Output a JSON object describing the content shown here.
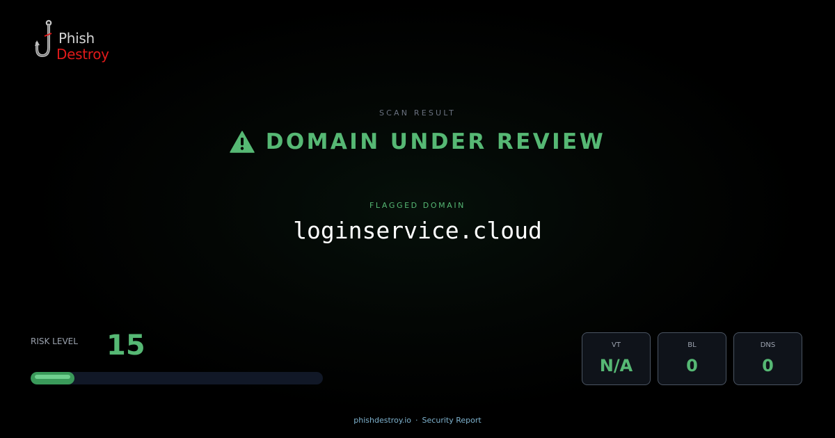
{
  "brand": {
    "line1": "Phish",
    "line2": "Destroy",
    "icon": "fishhook-icon",
    "colors": {
      "line1": "#d4d4d4",
      "line2": "#e01a1a"
    }
  },
  "header": {
    "eyebrow": "SCAN RESULT",
    "status_icon": "warning-triangle-icon",
    "status_title": "DOMAIN UNDER REVIEW"
  },
  "domain_section": {
    "label": "FLAGGED DOMAIN",
    "domain": "loginservice.cloud"
  },
  "risk": {
    "label": "RISK LEVEL",
    "value": "15",
    "bar_fraction": 0.15
  },
  "stats": [
    {
      "key": "VT",
      "value": "N/A"
    },
    {
      "key": "BL",
      "value": "0"
    },
    {
      "key": "DNS",
      "value": "0"
    }
  ],
  "footer": {
    "site": "phishdestroy.io",
    "separator": "·",
    "report": "Security Report"
  },
  "colors": {
    "accent": "#56b874",
    "background": "#000000",
    "muted": "#6b7280",
    "footer": "#7fb3cf"
  }
}
